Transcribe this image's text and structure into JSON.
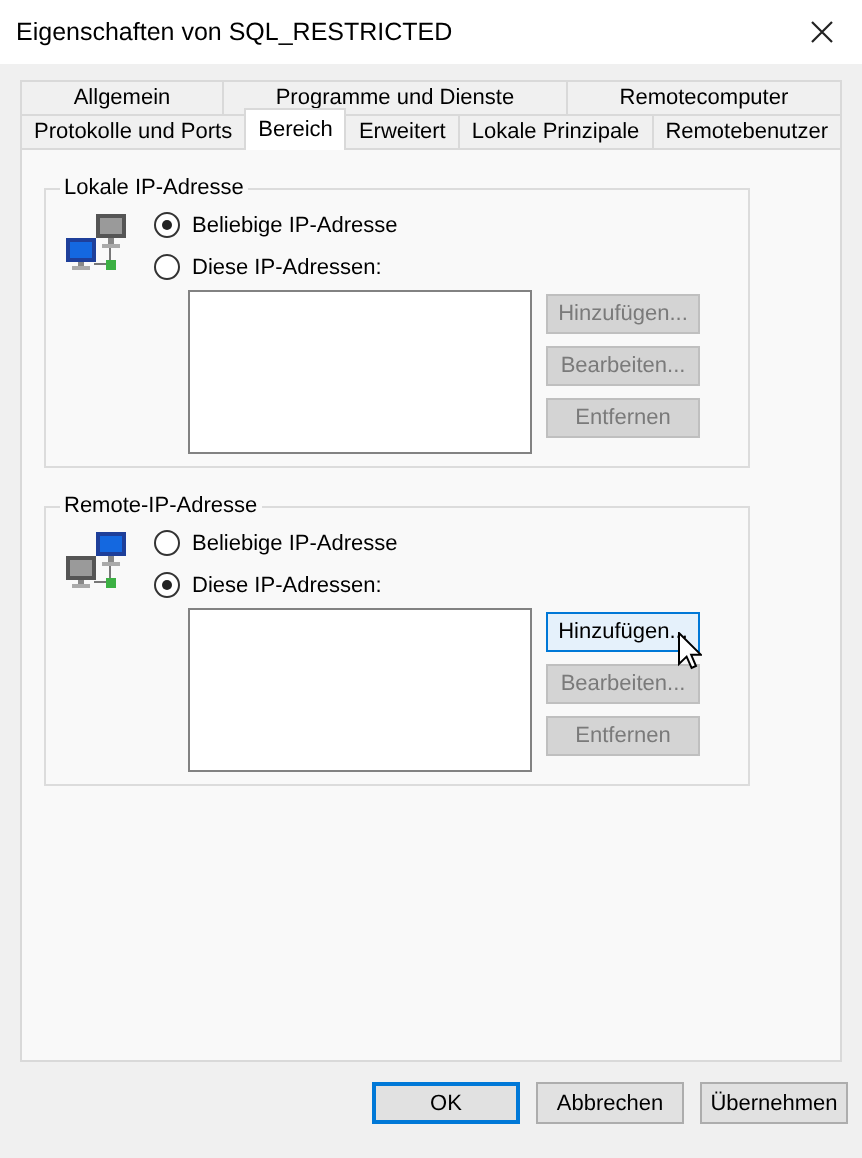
{
  "window": {
    "title": "Eigenschaften von SQL_RESTRICTED"
  },
  "tab_rows": [
    [
      {
        "label": "Allgemein",
        "selected": false
      },
      {
        "label": "Programme und Dienste",
        "selected": false
      },
      {
        "label": "Remotecomputer",
        "selected": false
      }
    ],
    [
      {
        "label": "Protokolle und Ports",
        "selected": false
      },
      {
        "label": "Bereich",
        "selected": true
      },
      {
        "label": "Erweitert",
        "selected": false
      },
      {
        "label": "Lokale Prinzipale",
        "selected": false
      },
      {
        "label": "Remotebenutzer",
        "selected": false
      }
    ]
  ],
  "groups": [
    {
      "title": "Lokale IP-Adresse",
      "kind": "local",
      "options": [
        {
          "label": "Beliebige IP-Adresse",
          "selected": true
        },
        {
          "label": "Diese IP-Adressen:",
          "selected": false
        }
      ],
      "buttons": [
        {
          "label": "Hinzufügen...",
          "disabled": true,
          "hovered": false
        },
        {
          "label": "Bearbeiten...",
          "disabled": true,
          "hovered": false
        },
        {
          "label": "Entfernen",
          "disabled": true,
          "hovered": false
        }
      ]
    },
    {
      "title": "Remote-IP-Adresse",
      "kind": "remote",
      "options": [
        {
          "label": "Beliebige IP-Adresse",
          "selected": false
        },
        {
          "label": "Diese IP-Adressen:",
          "selected": true
        }
      ],
      "buttons": [
        {
          "label": "Hinzufügen...",
          "disabled": false,
          "hovered": true
        },
        {
          "label": "Bearbeiten...",
          "disabled": true,
          "hovered": false
        },
        {
          "label": "Entfernen",
          "disabled": true,
          "hovered": false
        }
      ]
    }
  ],
  "footer_buttons": [
    {
      "label": "OK",
      "default": true
    },
    {
      "label": "Abbrechen",
      "default": false
    },
    {
      "label": "Übernehmen",
      "default": false
    }
  ]
}
